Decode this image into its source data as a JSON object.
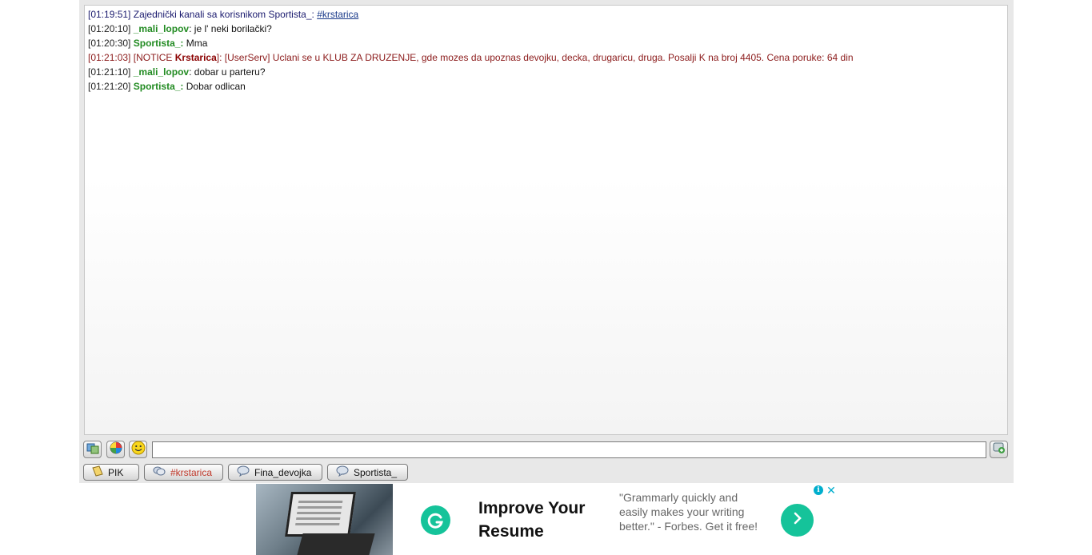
{
  "chat": {
    "lines": [
      {
        "ts": "[01:19:51]",
        "text": "Zajednički kanali sa korisnikom Sportista_:",
        "channel": "#krstarica"
      },
      {
        "ts": "[01:20:10]",
        "nick": "_mali_lopov",
        "sep": ":",
        "msg": "je l' neki borilački?"
      },
      {
        "ts": "[01:20:30]",
        "nick": "Sportista_",
        "sep": ":",
        "msg": "Mma"
      },
      {
        "ts": "[01:21:03]",
        "notice_prefix": "[NOTICE",
        "nick": "Krstarica",
        "notice_suffix": "]:",
        "msg": "[UserServ] Uclani se u KLUB ZA DRUZENJE, gde mozes da upoznas devojku, decka, drugaricu, druga. Posalji K na broj 4405. Cena poruke: 64 din"
      },
      {
        "ts": "[01:21:10]",
        "nick": "_mali_lopov",
        "sep": ":",
        "msg": "dobar u parteru?"
      },
      {
        "ts": "[01:21:20]",
        "nick": "Sportista_",
        "sep": ":",
        "msg": "Dobar odlican"
      }
    ]
  },
  "toolbar": {
    "icons": [
      "users-icon",
      "color-palette-icon",
      "smiley-icon",
      "send-icon"
    ],
    "input_value": ""
  },
  "tabs": [
    {
      "label": "PIK",
      "icon": "notepad-icon"
    },
    {
      "label": "#krstarica",
      "icon": "channel-icon"
    },
    {
      "label": "Fina_devojka",
      "icon": "speech-bubble-icon"
    },
    {
      "label": "Sportista_",
      "icon": "speech-bubble-icon"
    }
  ],
  "ad": {
    "headline": "Improve Your Resume",
    "quote": "\"Grammarly quickly and easily makes your writing better.\" - Forbes. Get it free!",
    "info_symbol": "i",
    "close_symbol": "✕",
    "colors": {
      "brand": "#15c39a",
      "adchoices": "#00aecd"
    }
  },
  "colors": {
    "system_text": "#1a1a6e",
    "nick_green": "#228b22",
    "notice_red": "#8b1a1a",
    "active_tab_text": "#c0392b"
  }
}
